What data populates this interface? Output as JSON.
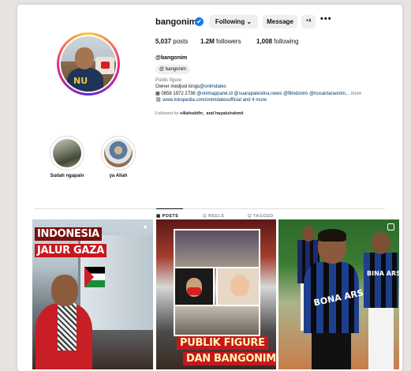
{
  "profile": {
    "username": "bangonim",
    "verified_mark": "✔",
    "following_button": "Following ⌄",
    "message_button": "Message",
    "add_user_icon": "⁺ᴬ",
    "more_icon": "•••",
    "posts_count": "5,037",
    "posts_label": "posts",
    "followers_count": "1.2M",
    "followers_label": "followers",
    "following_count": "1,008",
    "following_label": "following",
    "handle": "@bangonim",
    "threads_label": "bangonim",
    "threads_icon": "@",
    "category": "Public figure",
    "bio_line1_text": "Owner medjool kings",
    "bio_line1_link": "@onimdates",
    "bio_line2_icon": "▦",
    "bio_line2_phone": "0858 1972 2736",
    "bio_line2_links": "@onimapparel.id @suarapalestina.news @filindonim @nusantaraonim...",
    "bio_line2_more": "more",
    "bio_line3_icon": "🔗",
    "bio_line3_link": "www.tokopedia.com/onimdatesofficial and 4 more",
    "followed_by_prefix": "Followed by",
    "followed_by_names": "s4lahsddfn_ and hayatulrahmii"
  },
  "highlights": [
    {
      "label": "Sudah ngapain"
    },
    {
      "label": "ya Allah"
    }
  ],
  "tabs": [
    {
      "label": "POSTS",
      "icon": "▦"
    },
    {
      "label": "REELS",
      "icon": "⊡"
    },
    {
      "label": "TAGGED",
      "icon": "⊡"
    }
  ],
  "posts": [
    {
      "line1": "INDONESIA",
      "line2": "JALUR GAZA",
      "pin_icon": "📌"
    },
    {
      "line1": "PUBLIK FIGURE",
      "line2": "DAN BANGONIM"
    },
    {
      "jersey_text1": "BONA ARSA",
      "jersey_text2": "BINA ARSA"
    }
  ],
  "colors": {
    "verified": "#1877f2",
    "link": "#00376b",
    "button_bg": "#efefef"
  }
}
